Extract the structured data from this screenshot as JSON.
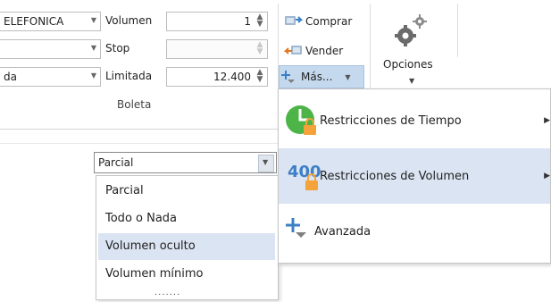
{
  "ribbon": {
    "instrument_combo": {
      "value": "ELEFONICA"
    },
    "side_combo": {
      "value": ""
    },
    "order_type_combo": {
      "value": "da"
    },
    "volumen": {
      "label": "Volumen",
      "value": "1"
    },
    "stop": {
      "label": "Stop",
      "value": ""
    },
    "limitada": {
      "label": "Limitada",
      "value": "12.400"
    },
    "group_name": "Boleta",
    "comprar_label": "Comprar",
    "vender_label": "Vender",
    "mas_label": "Más...",
    "opciones_label": "Opciones"
  },
  "menu": {
    "items": [
      {
        "label": "Restricciones de Tiempo",
        "icon": "clock-lock-icon"
      },
      {
        "label": "Restricciones de Volumen",
        "icon_text": "400",
        "icon": "volume-lock-icon"
      },
      {
        "label": "Avanzada",
        "icon": "plus-arrow-icon"
      }
    ]
  },
  "dropdown": {
    "selected": "Parcial",
    "options": [
      "Parcial",
      "Todo o Nada",
      "Volumen oculto",
      "Volumen mínimo"
    ],
    "highlighted_index": 2,
    "grip": "......."
  },
  "colors": {
    "accent_blue": "#3d7fc6",
    "highlight": "#dbe4f2",
    "lock_orange": "#f4a33b",
    "clock_green": "#4db447"
  }
}
